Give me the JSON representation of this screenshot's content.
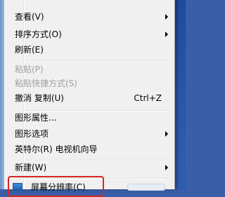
{
  "menu": {
    "items": [
      {
        "label": "查看(V)",
        "submenu": true
      },
      {
        "label": "排序方式(O)",
        "submenu": true
      },
      {
        "label": "刷新(E)"
      },
      {
        "label": "粘贴(P)",
        "disabled": true
      },
      {
        "label": "粘贴快捷方式(S)",
        "disabled": true
      },
      {
        "label": "撤消 复制(U)",
        "shortcut": "Ctrl+Z"
      },
      {
        "label": "图形属性..."
      },
      {
        "label": "图形选项",
        "submenu": true
      },
      {
        "label": "英特尔(R) 电视机向导"
      },
      {
        "label": "新建(W)",
        "submenu": true
      },
      {
        "label": "屏幕分辨率(C)",
        "icon": "display-icon"
      }
    ]
  },
  "colors": {
    "menu_bg": "#f0f0f0",
    "highlight_border": "#d8261f",
    "disabled_text": "#a0a0a0"
  }
}
